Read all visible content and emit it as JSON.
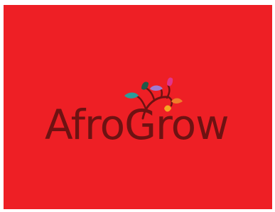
{
  "brand": {
    "name_part1": "Afro",
    "name_part2": "Grow",
    "background_color": "#ee1f25",
    "text_color": "#6e1212",
    "leaf_colors": [
      "#2a9d9a",
      "#1f5a4a",
      "#a07bd0",
      "#e0358c",
      "#ef7d2a",
      "#f5a623"
    ]
  }
}
